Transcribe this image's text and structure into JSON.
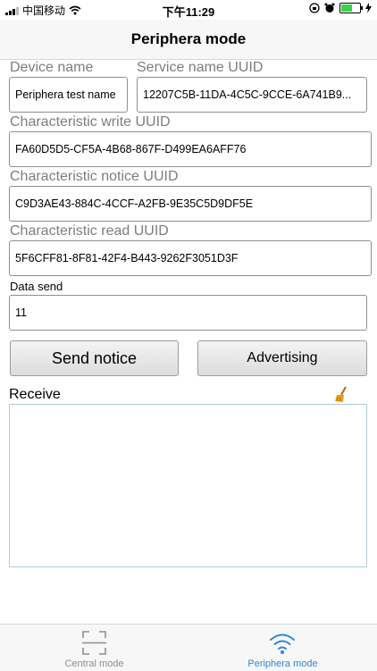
{
  "status_bar": {
    "carrier": "中国移动",
    "time": "下午11:29"
  },
  "nav": {
    "title": "Periphera mode"
  },
  "form": {
    "device_name": {
      "label": "Device name",
      "value": "Periphera test name"
    },
    "service_uuid": {
      "label": "Service name UUID",
      "value": "12207C5B-11DA-4C5C-9CCE-6A741B9..."
    },
    "write_uuid": {
      "label": "Characteristic write UUID",
      "value": "FA60D5D5-CF5A-4B68-867F-D499EA6AFF76"
    },
    "notice_uuid": {
      "label": "Characteristic notice UUID",
      "value": "C9D3AE43-884C-4CCF-A2FB-9E35C5D9DF5E"
    },
    "read_uuid": {
      "label": "Characteristic read UUID",
      "value": "5F6CFF81-8F81-42F4-B443-9262F3051D3F"
    },
    "data_send": {
      "label": "Data send",
      "value": "11"
    }
  },
  "buttons": {
    "send_notice": "Send notice",
    "advertising": "Advertising"
  },
  "receive": {
    "label": "Receive",
    "value": ""
  },
  "tab_bar": {
    "tabs": [
      {
        "label": "Central mode",
        "icon": "scan-icon",
        "active": false
      },
      {
        "label": "Periphera mode",
        "icon": "wifi-icon",
        "active": true
      }
    ],
    "active_color": "#2f86d8",
    "inactive_color": "#8e8e93"
  },
  "colors": {
    "battery": "#3cd24a",
    "clear_icon": "#e8a21a"
  }
}
